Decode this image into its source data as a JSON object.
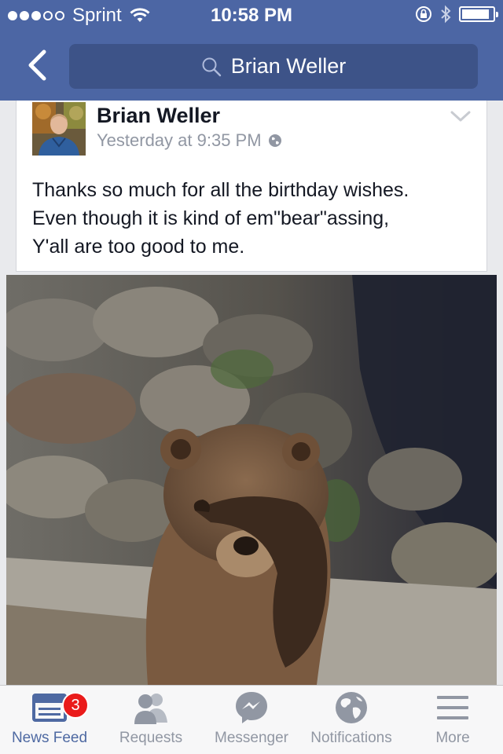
{
  "status_bar": {
    "carrier": "Sprint",
    "time": "10:58 PM",
    "signal_bars": 3,
    "battery_level": 0.9
  },
  "nav": {
    "back_icon": "chevron-left-icon",
    "search_text": "Brian Weller"
  },
  "post": {
    "author": "Brian Weller",
    "timestamp": "Yesterday at 9:35 PM",
    "privacy_icon": "globe-icon",
    "text_lines": [
      "Thanks so much for all the birthday wishes.",
      "Even though it is kind of em\"bear\"assing,",
      "Y'all are too good to me."
    ]
  },
  "tab_bar": {
    "items": [
      {
        "label": "News Feed",
        "icon": "news-feed-icon",
        "active": true,
        "badge": "3"
      },
      {
        "label": "Requests",
        "icon": "friend-requests-icon",
        "active": false
      },
      {
        "label": "Messenger",
        "icon": "messenger-icon",
        "active": false
      },
      {
        "label": "Notifications",
        "icon": "globe-icon",
        "active": false
      },
      {
        "label": "More",
        "icon": "hamburger-menu-icon",
        "active": false
      }
    ]
  },
  "colors": {
    "brand_blue": "#4c66a4",
    "search_field": "#3d5388",
    "badge_red": "#ea1b1b",
    "active_tab": "#4e69a2",
    "inactive_tab": "#9197a3"
  }
}
